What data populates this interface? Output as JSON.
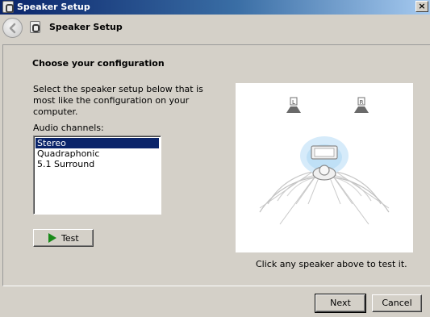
{
  "window": {
    "title": "Speaker Setup",
    "close_glyph": "×"
  },
  "nav": {
    "title": "Speaker Setup",
    "back_icon": "back-arrow-icon"
  },
  "main": {
    "heading": "Choose your configuration",
    "instructions": "Select the speaker setup below that is most like the configuration on your computer.",
    "channels_label": "Audio channels:",
    "channels": [
      "Stereo",
      "Quadraphonic",
      "5.1 Surround"
    ],
    "selected_channel": "Stereo",
    "test_button": "Test",
    "diagram": {
      "left_speaker_label": "L",
      "right_speaker_label": "R"
    },
    "hint": "Click any speaker above to test it."
  },
  "footer": {
    "next_button": "Next",
    "cancel_button": "Cancel"
  },
  "colors": {
    "titlebar_start": "#0a246a",
    "selection": "#0a246a",
    "play_green": "#1a8a1a",
    "dialog_bg": "#d4d0c8"
  }
}
